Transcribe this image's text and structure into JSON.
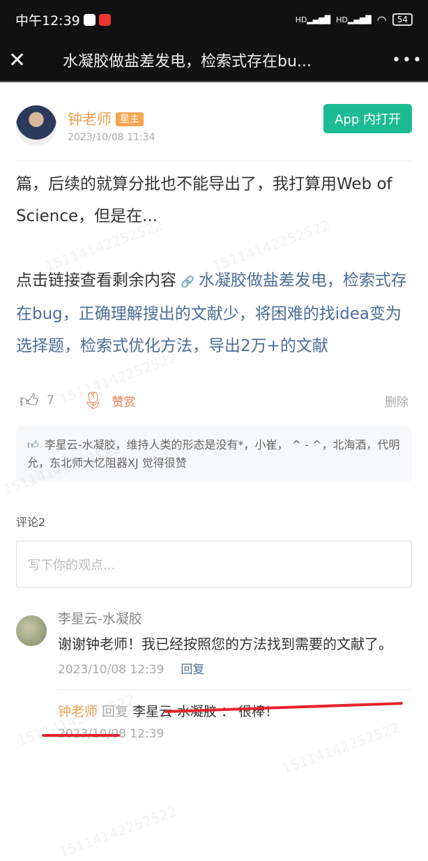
{
  "status": {
    "time": "中午12:39",
    "battery": "54",
    "signal": "HD"
  },
  "nav": {
    "title": "水凝胶做盐差发电，检索式存在bu...",
    "close": "✕",
    "more": "•••"
  },
  "post": {
    "author": "钟老师",
    "badge": "星主",
    "time": "2023/10/08 11:34",
    "open_app": "App 内打开",
    "text1": "篇，后续的就算分批也不能导出了，我打算用Web of Science，但是在...",
    "prompt": "点击链接查看剩余内容",
    "link_icon": "🔗",
    "link": "水凝胶做盐差发电，检索式存在bug，正确理解搜出的文献少，将困难的找idea变为选择题，检索式优化方法，导出2万+的文献",
    "like_count": "7",
    "reward": "赞赏",
    "delete": "删除",
    "likers": "李星云-水凝胶，维持人类的形态是没有*，小崔，  ^ - ^，北海酒，代明允，东北师大忆阻器XJ 觉得很赞"
  },
  "comments": {
    "label": "评论2",
    "placeholder": "写下你的观点...",
    "items": [
      {
        "author": "李星云-水凝胶",
        "text": "谢谢钟老师！我已经按照您的方法找到需要的文献了。",
        "time": "2023/10/08 12:39",
        "reply": "回复",
        "sub": {
          "author": "钟老师",
          "verb": "回复",
          "target": "李星云-水凝胶",
          "sep": "：",
          "text": "很棒！",
          "time": "2023/10/08 12:39"
        }
      }
    ]
  },
  "watermark": "15114142252522",
  "colors": {
    "accent": "#1dbb94",
    "link": "#4c6d96",
    "author": "#f0a050",
    "reward": "#f07848"
  }
}
